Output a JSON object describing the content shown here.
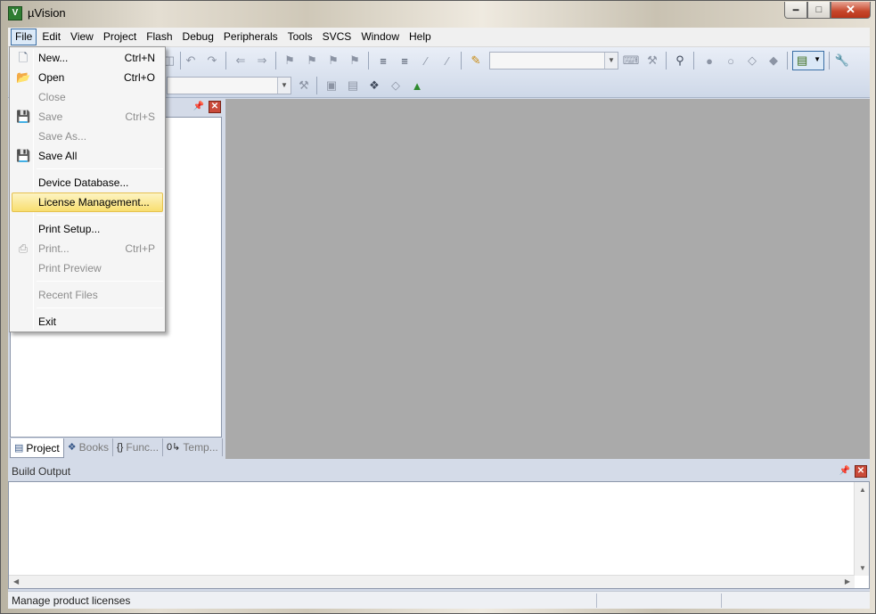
{
  "window": {
    "title": "µVision",
    "app_icon": "V"
  },
  "menubar": {
    "items": [
      "File",
      "Edit",
      "View",
      "Project",
      "Flash",
      "Debug",
      "Peripherals",
      "Tools",
      "SVCS",
      "Window",
      "Help"
    ],
    "active": "File"
  },
  "file_menu": {
    "items": [
      {
        "label": "New...",
        "accel": "Ctrl+N",
        "icon": "new-file-icon",
        "enabled": true
      },
      {
        "label": "Open",
        "accel": "Ctrl+O",
        "icon": "open-folder-icon",
        "enabled": true
      },
      {
        "label": "Close",
        "accel": "",
        "icon": "",
        "enabled": false
      },
      {
        "label": "Save",
        "accel": "Ctrl+S",
        "icon": "save-icon",
        "enabled": false
      },
      {
        "label": "Save As...",
        "accel": "",
        "icon": "",
        "enabled": false
      },
      {
        "label": "Save All",
        "accel": "",
        "icon": "save-all-icon",
        "enabled": true
      },
      {
        "label": "Device Database...",
        "accel": "",
        "icon": "",
        "enabled": true
      },
      {
        "label": "License Management...",
        "accel": "",
        "icon": "",
        "enabled": true,
        "highlighted": true
      },
      {
        "label": "Print Setup...",
        "accel": "",
        "icon": "",
        "enabled": true
      },
      {
        "label": "Print...",
        "accel": "Ctrl+P",
        "icon": "print-icon",
        "enabled": false
      },
      {
        "label": "Print Preview",
        "accel": "",
        "icon": "",
        "enabled": false
      },
      {
        "label": "Recent Files",
        "accel": "",
        "icon": "",
        "enabled": false
      },
      {
        "label": "Exit",
        "accel": "",
        "icon": "",
        "enabled": true
      }
    ]
  },
  "project_pane": {
    "tabs": [
      "Project",
      "Books",
      "Func...",
      "Temp..."
    ],
    "active_tab": "Project"
  },
  "build_output": {
    "title": "Build Output"
  },
  "statusbar": {
    "text": "Manage product licenses"
  }
}
